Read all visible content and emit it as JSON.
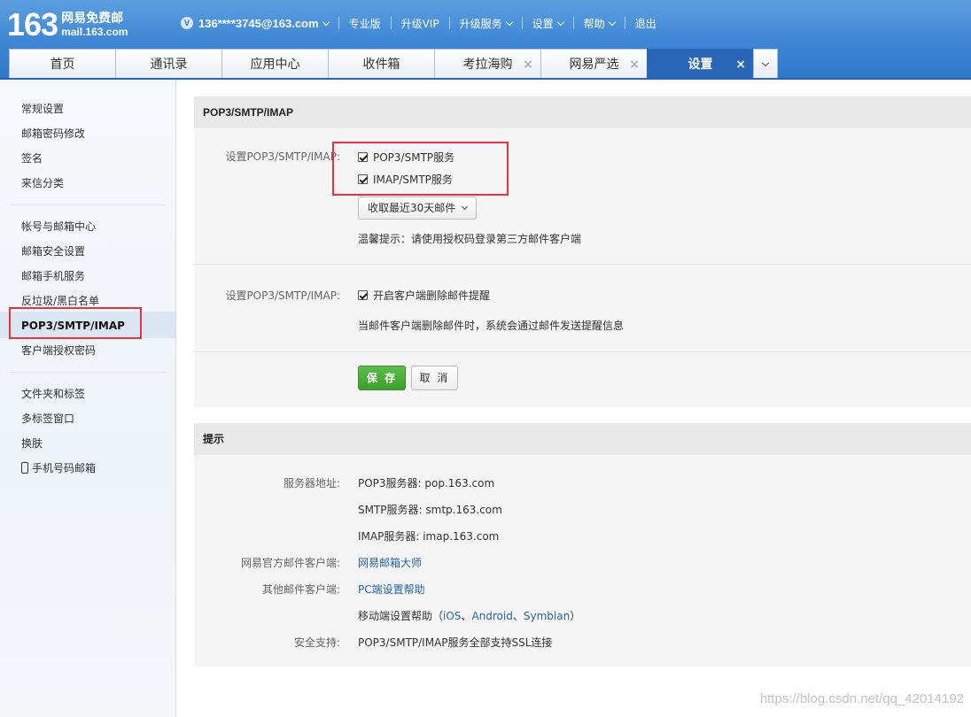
{
  "logo": {
    "number": "163",
    "cn": "网易免费邮",
    "en": "mail.163.com"
  },
  "topbar": {
    "vip_badge": "V",
    "account": "136****3745@163.com",
    "links": [
      "专业版",
      "升级VIP",
      "升级服务",
      "设置",
      "帮助",
      "退出"
    ]
  },
  "tabs": [
    {
      "label": "首页",
      "closable": false,
      "active": false
    },
    {
      "label": "通讯录",
      "closable": false,
      "active": false
    },
    {
      "label": "应用中心",
      "closable": false,
      "active": false
    },
    {
      "label": "收件箱",
      "closable": false,
      "active": false
    },
    {
      "label": "考拉海购",
      "closable": true,
      "active": false
    },
    {
      "label": "网易严选",
      "closable": true,
      "active": false
    },
    {
      "label": "设置",
      "closable": true,
      "active": true
    }
  ],
  "tab_close_glyph": "×",
  "sidebar": {
    "group1": [
      "常规设置",
      "邮箱密码修改",
      "签名",
      "来信分类"
    ],
    "group2": [
      "帐号与邮箱中心",
      "邮箱安全设置",
      "邮箱手机服务",
      "反垃圾/黑白名单",
      "POP3/SMTP/IMAP",
      "客户端授权密码"
    ],
    "group3": [
      "文件夹和标签",
      "多标签窗口",
      "换肤",
      "手机号码邮箱"
    ],
    "active": "POP3/SMTP/IMAP"
  },
  "section1": {
    "title": "POP3/SMTP/IMAP",
    "row1_label": "设置POP3/SMTP/IMAP:",
    "pop3_checkbox": "POP3/SMTP服务",
    "imap_checkbox": "IMAP/SMTP服务",
    "select_value": "收取最近30天邮件",
    "tip": "温馨提示：请使用授权码登录第三方邮件客户端",
    "row2_label": "设置POP3/SMTP/IMAP:",
    "delete_checkbox": "开启客户端删除邮件提醒",
    "delete_desc": "当邮件客户端删除邮件时，系统会通过邮件发送提醒信息",
    "save": "保 存",
    "cancel": "取 消"
  },
  "section2": {
    "title": "提示",
    "server_label": "服务器地址:",
    "pop3_server": "POP3服务器: pop.163.com",
    "smtp_server": "SMTP服务器: smtp.163.com",
    "imap_server": "IMAP服务器: imap.163.com",
    "official_label": "网易官方邮件客户端:",
    "official_link": "网易邮箱大师",
    "other_label": "其他邮件客户端:",
    "pc_link": "PC端设置帮助",
    "mobile_prefix": "移动端设置帮助（",
    "ios": "iOS",
    "android": "Android",
    "symbian": "Symbian",
    "sep": "、",
    "mobile_suffix": "）",
    "security_label": "安全支持:",
    "security_text": "POP3/SMTP/IMAP服务全部支持SSL连接"
  },
  "watermark": "https://blog.csdn.net/qq_42014192",
  "colors": {
    "header_blue": "#3d86d4",
    "active_tab": "#2767b5",
    "save_green": "#46a633",
    "highlight_red": "#e8323c",
    "link_blue": "#2764b0"
  }
}
